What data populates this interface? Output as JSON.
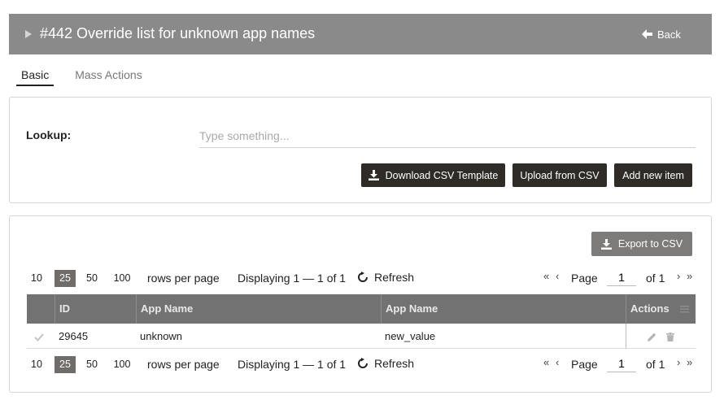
{
  "header": {
    "title": "#442 Override list for unknown app names",
    "back_label": "Back"
  },
  "tabs": [
    {
      "label": "Basic",
      "active": true
    },
    {
      "label": "Mass Actions",
      "active": false
    }
  ],
  "lookup": {
    "label": "Lookup:",
    "placeholder": "Type something...",
    "value": ""
  },
  "actions": {
    "download_label": "Download CSV Template",
    "upload_label": "Upload from CSV",
    "add_label": "Add new item",
    "export_label": "Export to CSV"
  },
  "pager": {
    "sizes": [
      "10",
      "25",
      "50",
      "100"
    ],
    "active_size": "25",
    "rows_per_page_label": "rows per page",
    "displaying_label": "Displaying 1 — 1 of 1",
    "refresh_label": "Refresh",
    "page_label": "Page",
    "page_value": "1",
    "of_label": "of 1",
    "first_icon": "«",
    "prev_icon": "‹",
    "next_icon": "›",
    "last_icon": "»"
  },
  "table": {
    "columns": [
      "ID",
      "App Name",
      "App Name",
      "Actions"
    ],
    "rows": [
      {
        "id": "29645",
        "app_name": "unknown",
        "new_value": "new_value"
      }
    ]
  },
  "colors": {
    "header_bg": "#8a8a8a",
    "dark_button": "#2f2b27",
    "export_button": "#7d7b79",
    "table_header": "#727272",
    "active_page_size": "#6f6c69"
  }
}
